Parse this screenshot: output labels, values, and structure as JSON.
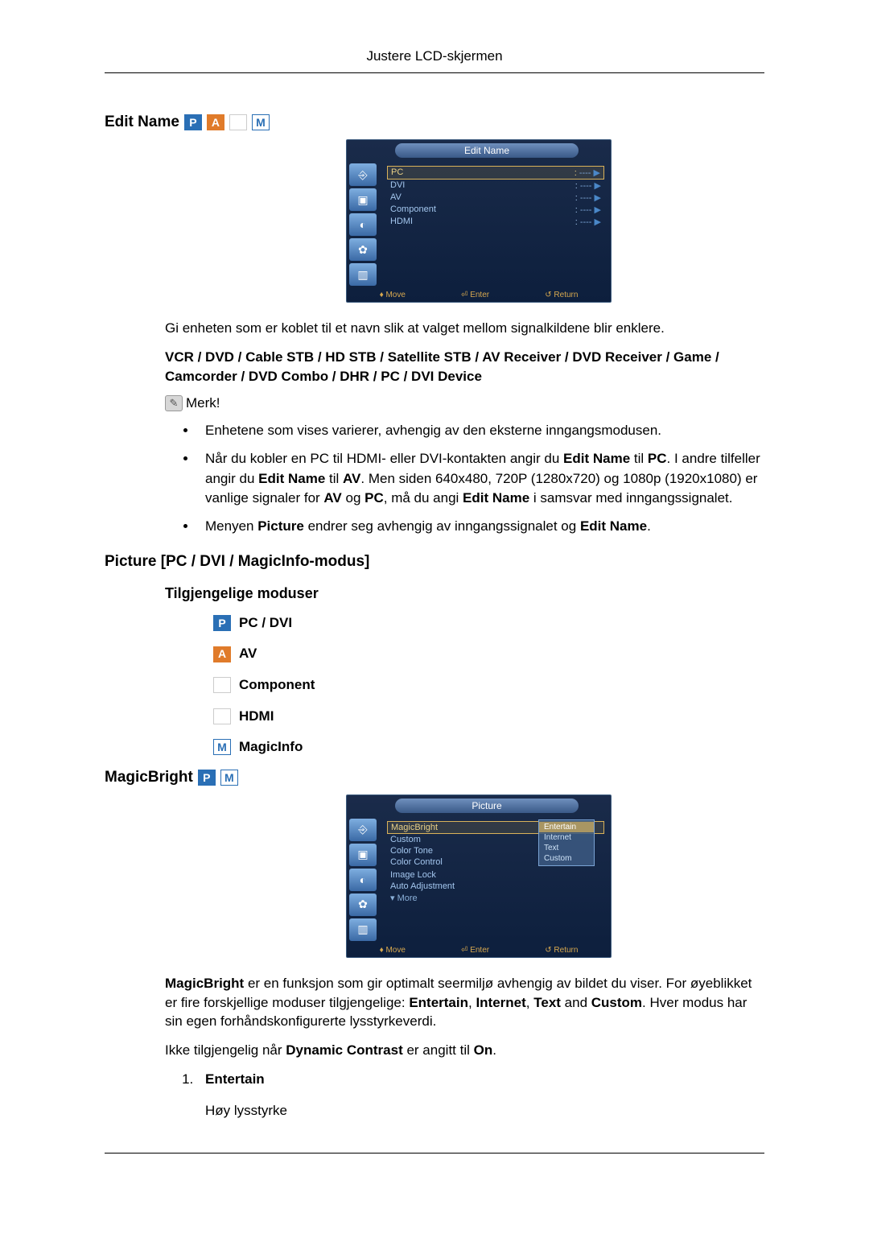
{
  "page_header": "Justere LCD-skjermen",
  "sections": {
    "edit_name": {
      "title": "Edit Name",
      "badges": [
        "P",
        "A",
        "",
        "M"
      ],
      "osd": {
        "title": "Edit Name",
        "rows": [
          {
            "label": "PC",
            "value": "----",
            "selected": true
          },
          {
            "label": "DVI",
            "value": "----",
            "selected": false
          },
          {
            "label": "AV",
            "value": "----",
            "selected": false
          },
          {
            "label": "Component",
            "value": "----",
            "selected": false
          },
          {
            "label": "HDMI",
            "value": "----",
            "selected": false
          }
        ],
        "footer": {
          "move": "Move",
          "enter": "Enter",
          "ret": "Return"
        }
      },
      "intro": "Gi enheten som er koblet til et navn slik at valget mellom signalkildene blir enklere.",
      "devices_bold": "VCR / DVD / Cable STB / HD STB / Satellite STB / AV Receiver / DVD Receiver / Game / Camcorder / DVD Combo / DHR / PC / DVI Device",
      "note_label": "Merk!",
      "bullets": [
        {
          "text": "Enhetene som vises varierer, avhengig av den eksterne inngangsmodusen."
        },
        {
          "text_parts": [
            "Når du kobler en PC til HDMI- eller DVI-kontakten angir du ",
            {
              "b": "Edit Name"
            },
            " til ",
            {
              "b": "PC"
            },
            ". I andre tilfeller angir du ",
            {
              "b": "Edit Name"
            },
            " til ",
            {
              "b": "AV"
            },
            ". Men siden 640x480, 720P (1280x720) og 1080p (1920x1080) er vanlige signaler for ",
            {
              "b": "AV"
            },
            " og ",
            {
              "b": "PC"
            },
            ", må du angi ",
            {
              "b": "Edit Name"
            },
            " i samsvar med inngangssignalet."
          ]
        },
        {
          "text_parts": [
            "Menyen ",
            {
              "b": "Picture"
            },
            " endrer seg avhengig av inngangssignalet og ",
            {
              "b": "Edit Name"
            },
            "."
          ]
        }
      ]
    },
    "picture": {
      "title": "Picture [PC / DVI / MagicInfo-modus]",
      "modes_title": "Tilgjengelige moduser",
      "modes": [
        {
          "badge": "P",
          "label": "PC / DVI"
        },
        {
          "badge": "A",
          "label": "AV"
        },
        {
          "badge": "",
          "label": "Component"
        },
        {
          "badge": "",
          "label": "HDMI"
        },
        {
          "badge": "M",
          "label": "MagicInfo"
        }
      ]
    },
    "magicbright": {
      "title": "MagicBright",
      "badges": [
        "P",
        "M"
      ],
      "osd": {
        "title": "Picture",
        "rows": [
          {
            "label": "MagicBright",
            "selected": true
          },
          {
            "label": "Custom"
          },
          {
            "label": "Color Tone"
          },
          {
            "label": "Color Control"
          },
          {
            "label": "",
            "disabled": true
          },
          {
            "label": "Image Lock"
          },
          {
            "label": "Auto Adjustment"
          },
          {
            "label": "▾ More",
            "more": true
          }
        ],
        "popup": [
          "Entertain",
          "Internet",
          "Text",
          "Custom"
        ],
        "footer": {
          "move": "Move",
          "enter": "Enter",
          "ret": "Return"
        }
      },
      "desc_parts": [
        {
          "b": "MagicBright"
        },
        " er en funksjon som gir optimalt seermiljø avhengig av bildet du viser. For øyeblikket er fire forskjellige moduser tilgjengelige: ",
        {
          "b": "Entertain"
        },
        ", ",
        {
          "b": "Internet"
        },
        ", ",
        {
          "b": "Text"
        },
        " and ",
        {
          "b": "Custom"
        },
        ". Hver modus har sin egen forhåndskonfigurerte lysstyrkeverdi."
      ],
      "note_parts": [
        "Ikke tilgjengelig når ",
        {
          "b": "Dynamic Contrast"
        },
        " er angitt til ",
        {
          "b": "On"
        },
        "."
      ],
      "numlist": [
        {
          "title": "Entertain",
          "body": "Høy lysstyrke"
        }
      ]
    }
  }
}
